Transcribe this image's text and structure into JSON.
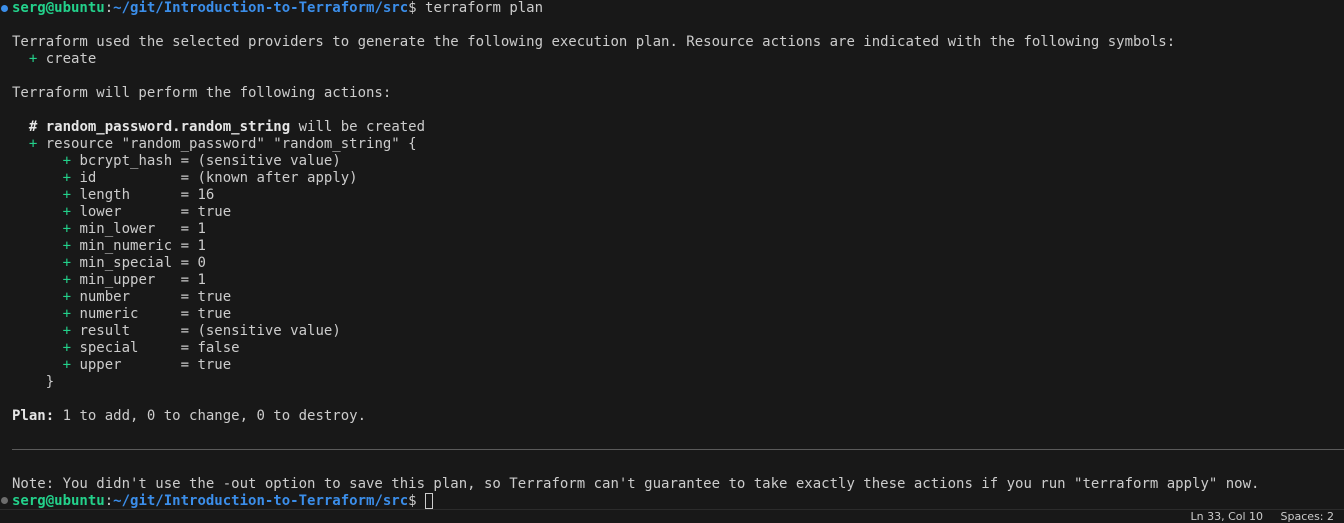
{
  "colors": {
    "background": "#181818",
    "prompt_user": "#23d18b",
    "prompt_path": "#3b8eea",
    "plus": "#23d18b",
    "dot_first": "#3b8eea",
    "dot_last": "#6c6c6c"
  },
  "prompt": {
    "user": "serg@ubuntu",
    "sep": ":",
    "path": "~/git/Introduction-to-Terraform/src",
    "suffix": "$ ",
    "command": "terraform plan"
  },
  "output": {
    "intro": "Terraform used the selected providers to generate the following execution plan. Resource actions are indicated with the following symbols:",
    "create_symbol": "+",
    "create_label": "create",
    "actions_header": "Terraform will perform the following actions:",
    "resource_comment_hash": "#",
    "resource_name": "random_password.random_string",
    "resource_status": " will be created",
    "resource_decl": "resource \"random_password\" \"random_string\" {",
    "attributes": [
      {
        "name": "bcrypt_hash",
        "value": "(sensitive value)"
      },
      {
        "name": "id",
        "value": "(known after apply)"
      },
      {
        "name": "length",
        "value": "16"
      },
      {
        "name": "lower",
        "value": "true"
      },
      {
        "name": "min_lower",
        "value": "1"
      },
      {
        "name": "min_numeric",
        "value": "1"
      },
      {
        "name": "min_special",
        "value": "0"
      },
      {
        "name": "min_upper",
        "value": "1"
      },
      {
        "name": "number",
        "value": "true"
      },
      {
        "name": "numeric",
        "value": "true"
      },
      {
        "name": "result",
        "value": "(sensitive value)"
      },
      {
        "name": "special",
        "value": "false"
      },
      {
        "name": "upper",
        "value": "true"
      }
    ],
    "close_brace": "}",
    "plan_label": "Plan:",
    "plan_summary": " 1 to add, 0 to change, 0 to destroy.",
    "note": "Note: You didn't use the -out option to save this plan, so Terraform can't guarantee to take exactly these actions if you run \"terraform apply\" now."
  },
  "status_bar": {
    "position": "Ln 33, Col 10",
    "spaces": "Spaces: 2"
  }
}
